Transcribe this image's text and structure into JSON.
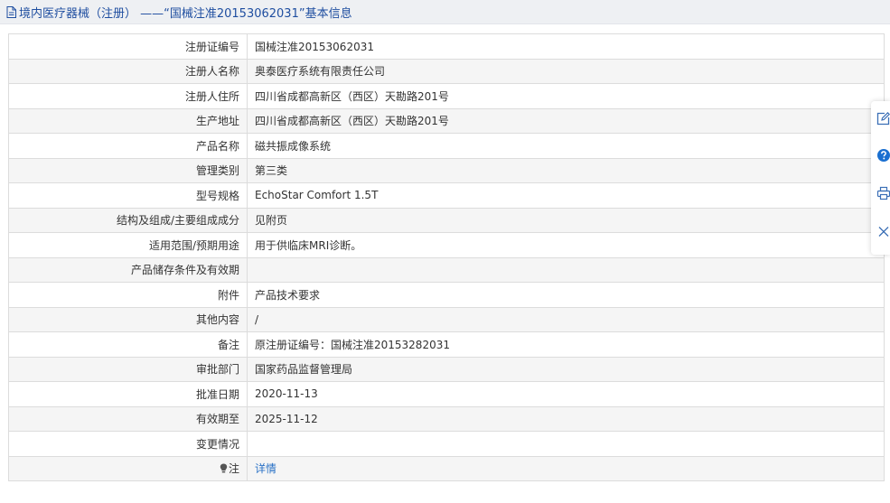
{
  "header": {
    "title": "境内医疗器械（注册） ——“国械注准20153062031”基本信息"
  },
  "fields": [
    {
      "label": "注册证编号",
      "value": "国械注准20153062031"
    },
    {
      "label": "注册人名称",
      "value": "奥泰医疗系统有限责任公司"
    },
    {
      "label": "注册人住所",
      "value": "四川省成都高新区（西区）天勘路201号"
    },
    {
      "label": "生产地址",
      "value": "四川省成都高新区（西区）天勘路201号"
    },
    {
      "label": "产品名称",
      "value": "磁共振成像系统"
    },
    {
      "label": "管理类别",
      "value": "第三类"
    },
    {
      "label": "型号规格",
      "value": "EchoStar Comfort 1.5T"
    },
    {
      "label": "结构及组成/主要组成成分",
      "value": "见附页"
    },
    {
      "label": "适用范围/预期用途",
      "value": "用于供临床MRI诊断。"
    },
    {
      "label": "产品储存条件及有效期",
      "value": ""
    },
    {
      "label": "附件",
      "value": "产品技术要求"
    },
    {
      "label": "其他内容",
      "value": "/"
    },
    {
      "label": "备注",
      "value": "原注册证编号：国械注准20153282031"
    },
    {
      "label": "审批部门",
      "value": "国家药品监督管理局"
    },
    {
      "label": "批准日期",
      "value": "2020-11-13"
    },
    {
      "label": "有效期至",
      "value": "2025-11-12"
    },
    {
      "label": "变更情况",
      "value": ""
    }
  ],
  "note": {
    "label": "注",
    "link": "详情"
  },
  "toolbar": {
    "icons": [
      "edit-icon",
      "help-icon",
      "print-icon",
      "close-icon"
    ]
  },
  "colors": {
    "title_text": "#1f4ea0",
    "link": "#2a72c6",
    "help_icon": "#1a6fd0"
  }
}
